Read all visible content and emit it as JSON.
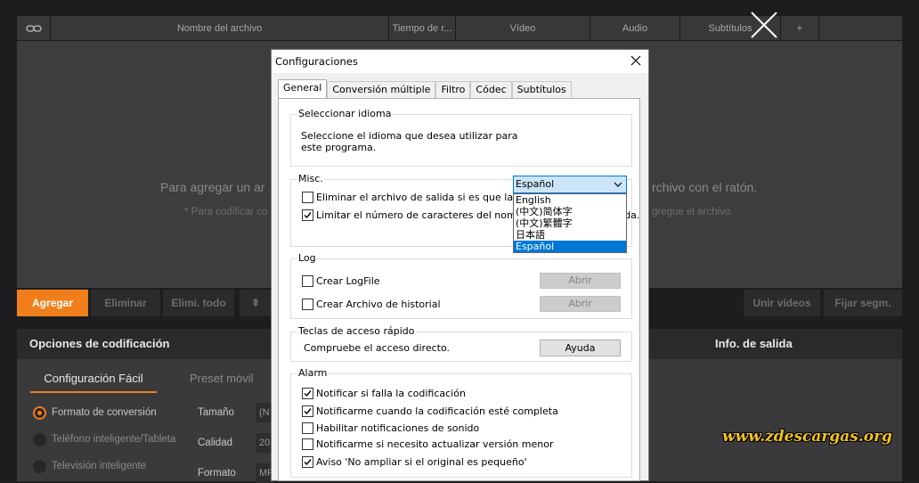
{
  "columns": {
    "filename": "Nombre del archivo",
    "time": "Tiempo de r...",
    "video": "Vídeo",
    "audio": "Audio",
    "subtitles": "Subtítulos",
    "add": "+"
  },
  "drop_area": {
    "main_left": "Para agregar un ar",
    "main_right": "rchivo con el ratón.",
    "sub_left": "* Para codificar co",
    "sub_right": "gregue el archivo."
  },
  "toolbar": {
    "add": "Agregar",
    "remove": "Eliminar",
    "remove_all": "Elimi. todo",
    "up_arrow": "⇞",
    "join": "Unir vídeos",
    "set_segment": "Fijar segm."
  },
  "options": {
    "title": "Opciones de codificación",
    "output_title": "Info. de salida",
    "tab_easy": "Configuración Fácil",
    "tab_preset": "Preset móvil",
    "radio_format": "Formato de conversión",
    "radio_phone": "Teléfono inteligente/Tableta",
    "radio_tv": "Televisión inteligente",
    "size_label": "Tamaño",
    "size_value": "(N",
    "quality_label": "Calidad",
    "quality_value": "20",
    "format_label": "Formato",
    "format_value": "MP"
  },
  "dialog": {
    "title": "Configuraciones",
    "tabs": [
      "General",
      "Conversión múltiple",
      "Filtro",
      "Códec",
      "Subtítulos"
    ],
    "language": {
      "group": "Seleccionar idioma",
      "prompt_line1": "Seleccione el idioma que desea utilizar para",
      "prompt_line2": "este programa.",
      "selected": "Español",
      "options": [
        "English",
        "(中文)简体字",
        "(中文)繁體字",
        "日本語",
        "Español"
      ]
    },
    "misc": {
      "group": "Misc.",
      "item1": "Eliminar el archivo de salida si es que la conve",
      "item2": "Limitar el número de caracteres del nombre del archivo de salida."
    },
    "log": {
      "group": "Log",
      "create_logfile": "Crear LogFile",
      "create_history": "Crear Archivo de historial",
      "open1": "Abrir",
      "open2": "Abrir"
    },
    "hotkeys": {
      "group": "Teclas de acceso rápido",
      "check_shortcut": "Compruebe el acceso directo.",
      "help": "Ayuda"
    },
    "alarm": {
      "group": "Alarm",
      "item1": "Notificar si falla la codificación",
      "item2": "Notificarme cuando la codificación esté completa",
      "item3": "Habilitar notificaciones de sonido",
      "item4": "Notificarme si necesito actualizar versión menor",
      "item5": "Aviso 'No ampliar si el original es pequeño'"
    }
  },
  "watermark": "www.zdescargas.org",
  "colors": {
    "accent": "#f07f1b",
    "selection": "#0078d7",
    "watermark": "#f1c21b"
  }
}
